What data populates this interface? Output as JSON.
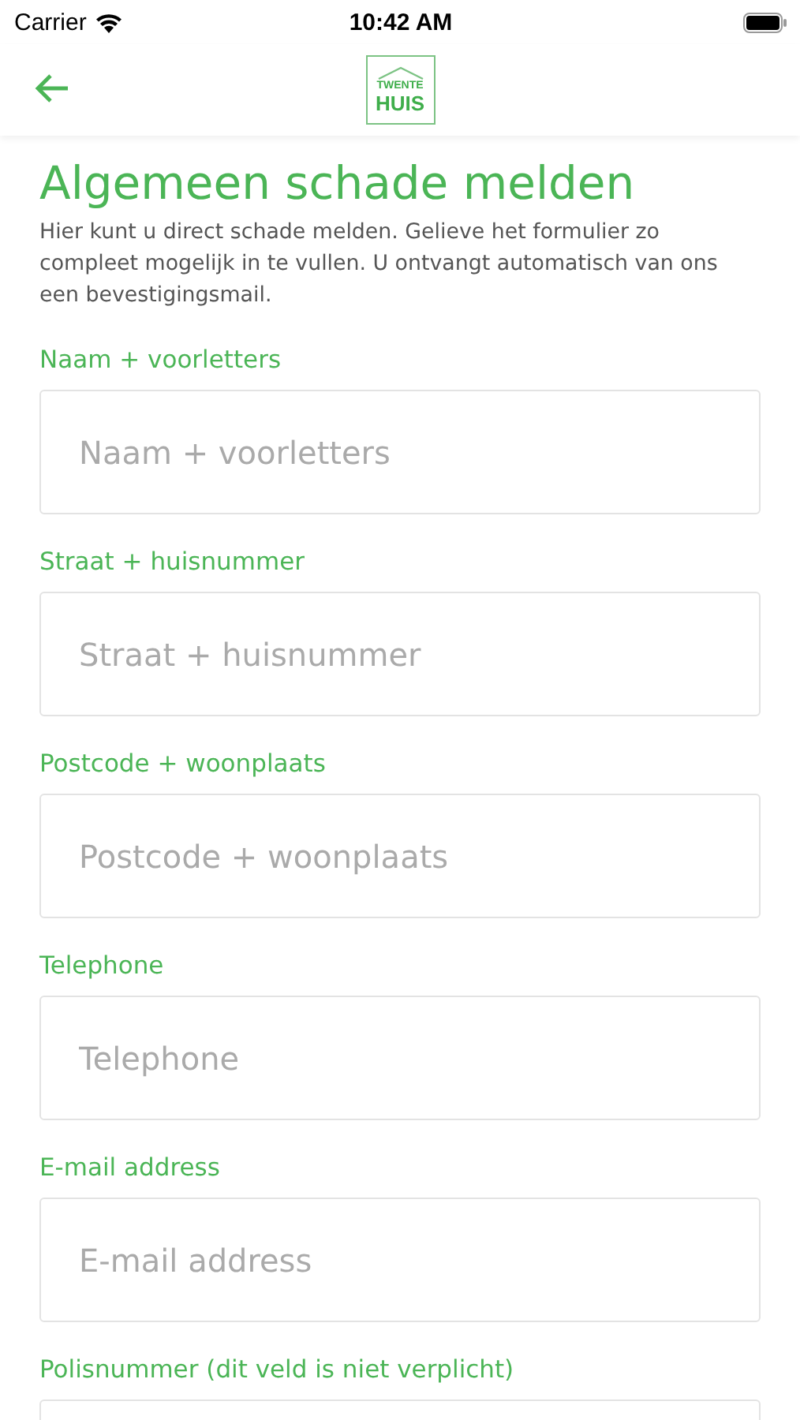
{
  "status_bar": {
    "carrier": "Carrier",
    "time": "10:42 AM"
  },
  "nav": {
    "logo": {
      "line_1": "TWENTE",
      "line_2": "HUIS"
    }
  },
  "title": "Algemeen schade melden",
  "intro": "Hier kunt u direct schade melden. Gelieve het formulier zo compleet mogelijk in te vullen. U ontvangt automatisch van ons een bevestigingsmail.",
  "fields": [
    {
      "label": "Naam + voorletters",
      "placeholder": "Naam + voorletters"
    },
    {
      "label": "Straat + huisnummer",
      "placeholder": "Straat + huisnummer"
    },
    {
      "label": "Postcode + woonplaats",
      "placeholder": "Postcode + woonplaats"
    },
    {
      "label": "Telephone",
      "placeholder": "Telephone"
    },
    {
      "label": "E-mail address",
      "placeholder": "E-mail address"
    },
    {
      "label": "Polisnummer (dit veld is niet verplicht)"
    }
  ]
}
